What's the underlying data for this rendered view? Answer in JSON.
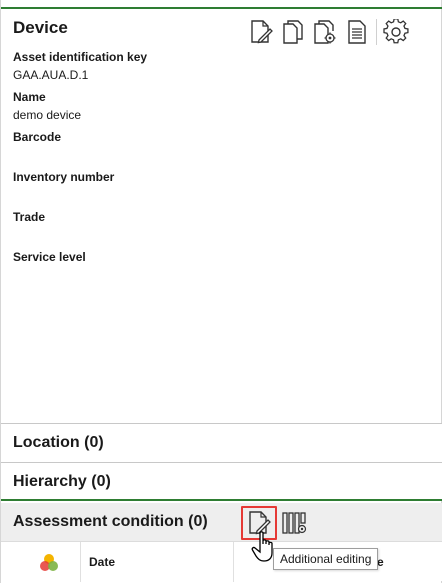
{
  "device": {
    "title": "Device",
    "toolbar": {
      "edit_icon": "document-edit-icon",
      "copy_icon": "copy-documents-icon",
      "settings_docs_icon": "document-settings-icon",
      "report_icon": "document-text-icon",
      "gear_icon": "gear-icon"
    },
    "fields": [
      {
        "label": "Asset identification key",
        "value": "GAA.AUA.D.1"
      },
      {
        "label": "Name",
        "value": "demo device"
      },
      {
        "label": "Barcode",
        "value": ""
      },
      {
        "label": "Inventory number",
        "value": ""
      },
      {
        "label": "Trade",
        "value": ""
      },
      {
        "label": "Service level",
        "value": ""
      }
    ]
  },
  "sections": {
    "location": "Location (0)",
    "hierarchy": "Hierarchy (0)",
    "assessment": "Assessment condition (0)"
  },
  "assessment_table": {
    "col_date": "Date",
    "col_partial": "e"
  },
  "tooltip": "Additional editing",
  "colors": {
    "accent_green": "#2e7d32",
    "highlight_red": "#e53935"
  }
}
